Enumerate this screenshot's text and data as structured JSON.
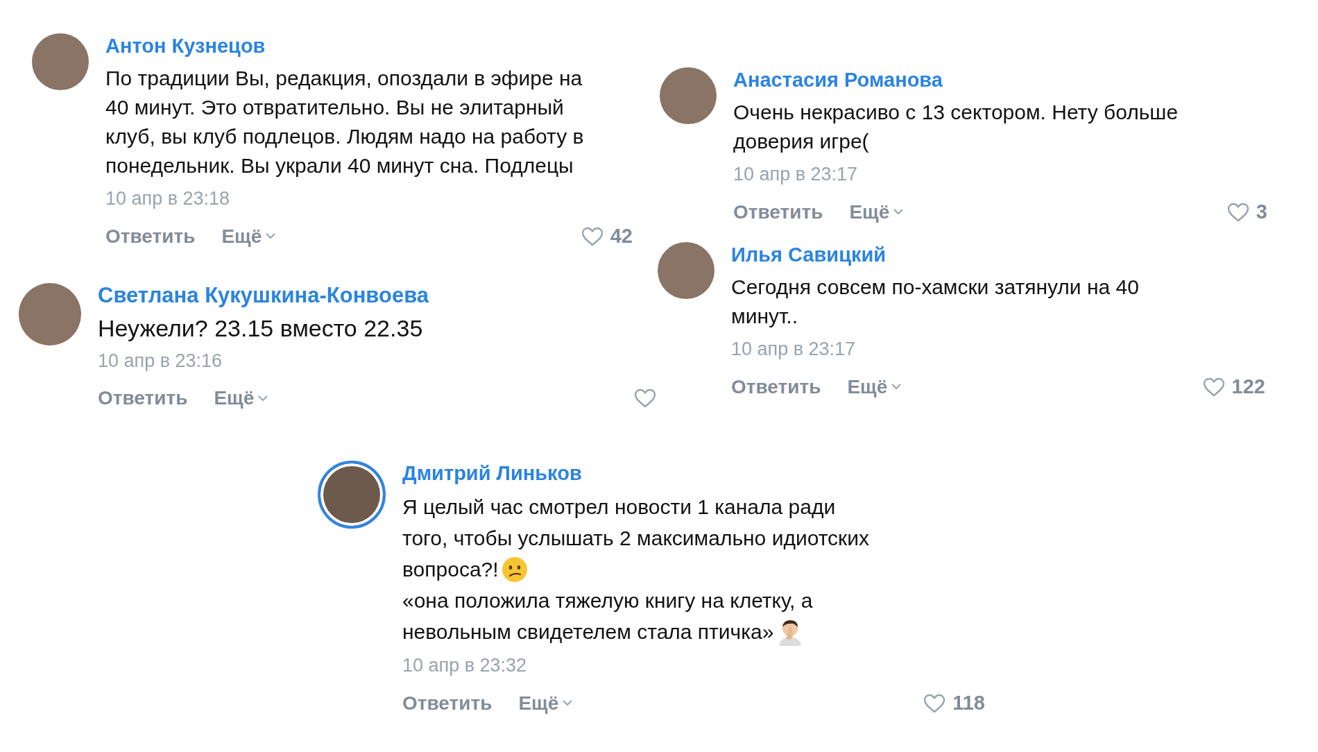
{
  "comments": [
    {
      "author": "Антон Кузнецов",
      "story": false,
      "lines": [
        {
          "text": "По традиции Вы, редакция, опоздали в эфире на"
        },
        {
          "text": "40 минут. Это отвратительно. Вы не элитарный"
        },
        {
          "text": "клуб, вы клуб подлецов. Людям надо на работу в"
        },
        {
          "text": "понедельник. Вы украли 40 минут сна. Подлецы"
        }
      ],
      "date": "10 апр в 23:18",
      "reply": "Ответить",
      "more": "Ещё",
      "likes": "42"
    },
    {
      "author": "Светлана Кукушкина-Конвоева",
      "story": false,
      "lines": [
        {
          "text": "Неужели? 23.15 вместо 22.35"
        }
      ],
      "date": "10 апр в 23:16",
      "reply": "Ответить",
      "more": "Ещё"
    },
    {
      "author": "Анастасия Романова",
      "story": false,
      "lines": [
        {
          "text": "Очень некрасиво с 13 сектором. Нету больше"
        },
        {
          "text": "доверия игре("
        }
      ],
      "date": "10 апр в 23:17",
      "reply": "Ответить",
      "more": "Ещё",
      "likes": "3"
    },
    {
      "author": "Илья Савицкий",
      "story": false,
      "lines": [
        {
          "text": "Сегодня совсем по-хамски затянули на 40"
        },
        {
          "text": "минут.."
        }
      ],
      "date": "10 апр в 23:17",
      "reply": "Ответить",
      "more": "Ещё",
      "likes": "122"
    },
    {
      "author": "Дмитрий Линьков",
      "story": true,
      "lines": [
        {
          "text": "Я целый час смотрел новости 1 канала ради"
        },
        {
          "text": "того, чтобы услышать 2 максимально идиотских"
        },
        {
          "text": "вопроса?!",
          "kind": "confused"
        },
        {
          "text": "«она положила тяжелую книгу на клетку, а"
        },
        {
          "text": "невольным свидетелем стала птичка»",
          "kind": "facepalm"
        }
      ],
      "date": "10 апр в 23:32",
      "reply": "Ответить",
      "more": "Ещё",
      "likes": "118"
    }
  ]
}
